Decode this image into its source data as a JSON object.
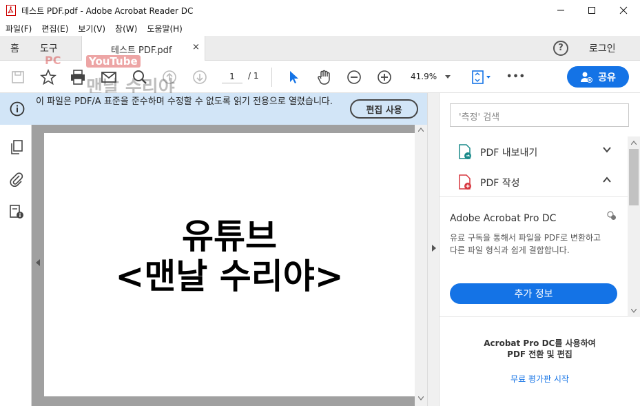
{
  "window": {
    "title": "테스트 PDF.pdf - Adobe Acrobat Reader DC"
  },
  "menu": {
    "items": [
      "파일(F)",
      "편집(E)",
      "보기(V)",
      "창(W)",
      "도움말(H)"
    ]
  },
  "tabs": {
    "home": "홈",
    "tools": "도구",
    "document": "테스트 PDF.pdf",
    "close": "×",
    "help": "?",
    "login": "로그인"
  },
  "toolbar": {
    "page_current": "1",
    "page_total": "/ 1",
    "zoom": "41.9%",
    "more": "•••",
    "share_label": "공유"
  },
  "notice": {
    "message": "이 파일은 PDF/A 표준을 준수하며 수정할 수 없도록 읽기 전용으로 열렸습니다.",
    "edit_button": "편집 사용"
  },
  "document": {
    "line1": "유튜브",
    "line2": "<맨날 수리야>"
  },
  "rightpane": {
    "search_placeholder": "'측정' 검색",
    "export_pdf": "PDF 내보내기",
    "create_pdf": "PDF 작성",
    "promo_title": "Adobe Acrobat Pro DC",
    "promo_desc": "유료 구독을 통해서 파일을 PDF로 변환하고 다른 파일 형식과 쉽게 결합합니다.",
    "more_info": "추가 정보",
    "bottom_promo_line1": "Acrobat Pro DC를 사용하여",
    "bottom_promo_line2": "PDF 전환 및 편집",
    "trial_link": "무료 평가판 시작"
  },
  "watermark": {
    "pc": "PC",
    "youtube": "YouTube",
    "text": "맨날 수리야"
  },
  "colors": {
    "accent": "#1473e6",
    "notice_bg": "#d2e5f7",
    "doc_bg": "#a0a0a0"
  }
}
